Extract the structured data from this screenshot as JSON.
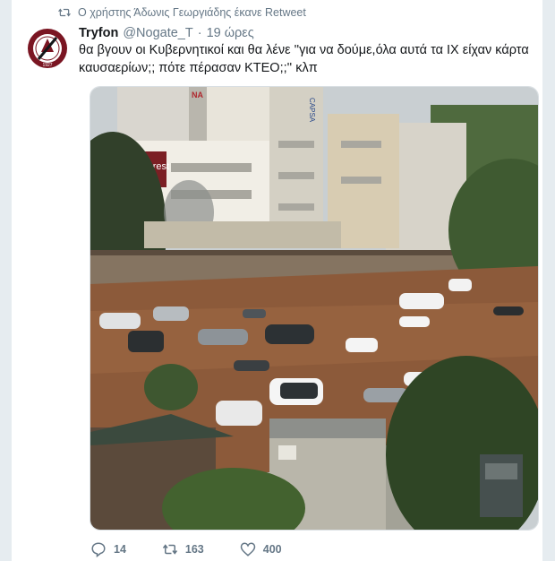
{
  "retweet": {
    "text": "Ο χρήστης Άδωνις Γεωργιάδης έκανε Retweet",
    "icon": "retweet-icon"
  },
  "tweet": {
    "author_name": "Tryfon",
    "author_handle": "@Nogate_T",
    "separator": "·",
    "time": "19 ώρες",
    "text_line1": "θα βγουν οι Κυβερνητικοί και θα λένε ''για να δούμε,όλα αυτά τα ΙΧ είχαν κάρτα",
    "text_line2": "καυσαερίων;; πότε πέρασαν ΚΤΕΟ;;'' κλπ",
    "avatar": {
      "year_text": "1927",
      "icon": "club-crest-avatar"
    },
    "media": {
      "description_icon": "flood-photo",
      "signs": {
        "billboard": "everest",
        "vertical": "CAPSA",
        "corner": "NA"
      }
    }
  },
  "actions": {
    "reply": {
      "icon": "reply-icon",
      "count": "14"
    },
    "retweet": {
      "icon": "retweet-icon",
      "count": "163"
    },
    "like": {
      "icon": "heart-icon",
      "count": "400"
    }
  },
  "colors": {
    "meta": "#657786",
    "text": "#14171a",
    "avatar_red": "#7a1522",
    "background": "#e6ecf0"
  }
}
